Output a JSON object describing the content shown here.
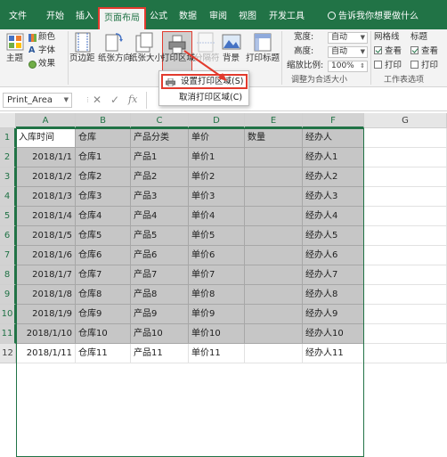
{
  "tabs": [
    {
      "label": "文件",
      "active": false
    },
    {
      "label": "开始",
      "active": false
    },
    {
      "label": "插入",
      "active": false
    },
    {
      "label": "页面布局",
      "active": true
    },
    {
      "label": "公式",
      "active": false
    },
    {
      "label": "数据",
      "active": false
    },
    {
      "label": "审阅",
      "active": false
    },
    {
      "label": "视图",
      "active": false
    },
    {
      "label": "开发工具",
      "active": false
    }
  ],
  "tell_me": "告诉我你想要做什么",
  "ribbon": {
    "theme_label": "主题",
    "color_label": "颜色",
    "font_label": "字体",
    "effect_label": "效果",
    "margins_label": "页边距",
    "orientation_label": "纸张方向",
    "size_label": "纸张大小",
    "print_area_label": "打印区域",
    "breaks_label": "分隔符",
    "background_label": "背景",
    "print_titles_label": "打印标题",
    "width_label": "宽度:",
    "width_value": "自动",
    "height_label": "高度:",
    "height_value": "自动",
    "scale_label": "缩放比例:",
    "scale_value": "100%",
    "fit_group_label": "调整为合适大小",
    "gridlines_label": "网格线",
    "headings_label": "标题",
    "view_label": "查看",
    "print_label": "打印",
    "sheet_options_label": "工作表选项"
  },
  "print_area_menu": {
    "set": "设置打印区域(S)",
    "clear": "取消打印区域(C)"
  },
  "formula_bar": {
    "name_box": "Print_Area",
    "cancel_glyph": "✕",
    "enter_glyph": "✓",
    "fx_glyph": "fx"
  },
  "columns": [
    "A",
    "B",
    "C",
    "D",
    "E",
    "F",
    "G"
  ],
  "header_row": [
    "入库时间",
    "仓库",
    "产品分类",
    "单价",
    "数量",
    "经办人"
  ],
  "rows": [
    {
      "num": "2",
      "date": "2018/1/1",
      "warehouse": "仓库1",
      "category": "产品1",
      "price": "单价1",
      "qty": "",
      "handler": "经办人1"
    },
    {
      "num": "3",
      "date": "2018/1/2",
      "warehouse": "仓库2",
      "category": "产品2",
      "price": "单价2",
      "qty": "",
      "handler": "经办人2"
    },
    {
      "num": "4",
      "date": "2018/1/3",
      "warehouse": "仓库3",
      "category": "产品3",
      "price": "单价3",
      "qty": "",
      "handler": "经办人3"
    },
    {
      "num": "5",
      "date": "2018/1/4",
      "warehouse": "仓库4",
      "category": "产品4",
      "price": "单价4",
      "qty": "",
      "handler": "经办人4"
    },
    {
      "num": "6",
      "date": "2018/1/5",
      "warehouse": "仓库5",
      "category": "产品5",
      "price": "单价5",
      "qty": "",
      "handler": "经办人5"
    },
    {
      "num": "7",
      "date": "2018/1/6",
      "warehouse": "仓库6",
      "category": "产品6",
      "price": "单价6",
      "qty": "",
      "handler": "经办人6"
    },
    {
      "num": "8",
      "date": "2018/1/7",
      "warehouse": "仓库7",
      "category": "产品7",
      "price": "单价7",
      "qty": "",
      "handler": "经办人7"
    },
    {
      "num": "9",
      "date": "2018/1/8",
      "warehouse": "仓库8",
      "category": "产品8",
      "price": "单价8",
      "qty": "",
      "handler": "经办人8"
    },
    {
      "num": "10",
      "date": "2018/1/9",
      "warehouse": "仓库9",
      "category": "产品9",
      "price": "单价9",
      "qty": "",
      "handler": "经办人9"
    },
    {
      "num": "11",
      "date": "2018/1/10",
      "warehouse": "仓库10",
      "category": "产品10",
      "price": "单价10",
      "qty": "",
      "handler": "经办人10"
    },
    {
      "num": "12",
      "date": "2018/1/11",
      "warehouse": "仓库11",
      "category": "产品11",
      "price": "单价11",
      "qty": "",
      "handler": "经办人11"
    }
  ],
  "colors": {
    "accent": "#217346",
    "highlight": "#e23b2e",
    "selection_shade": "#c6c6c6"
  }
}
